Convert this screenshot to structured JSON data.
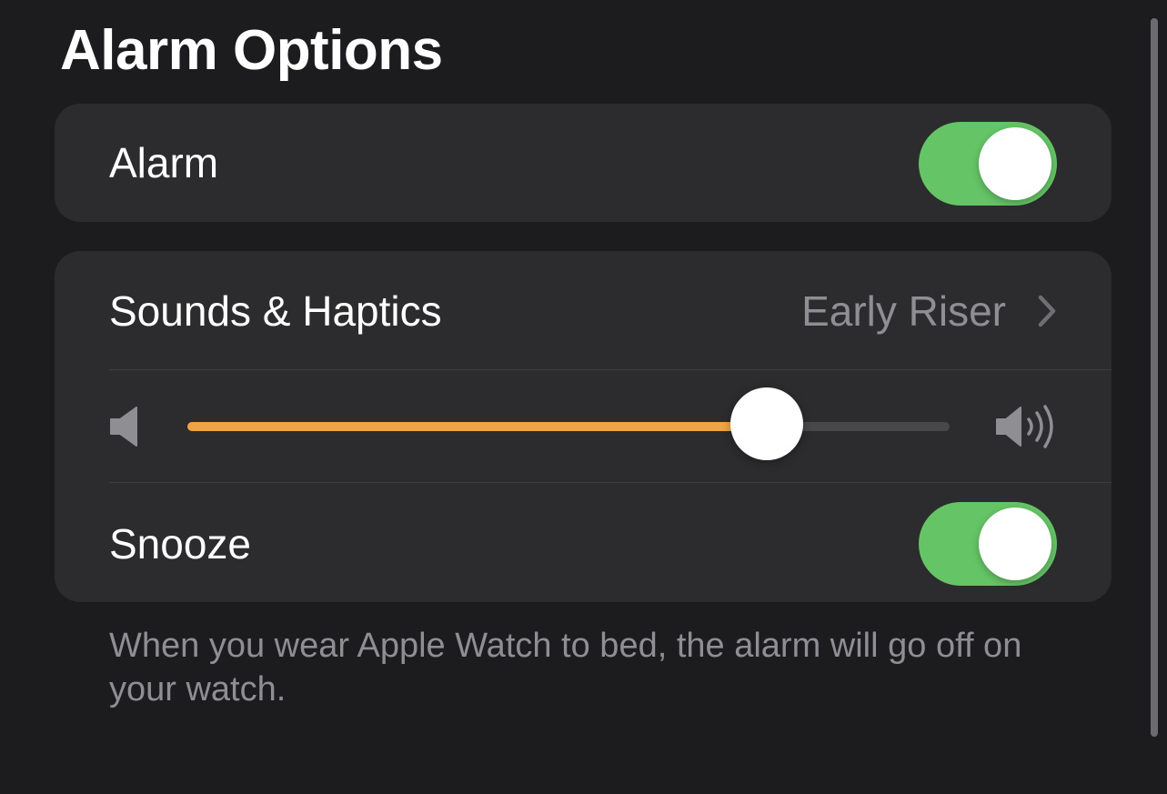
{
  "header": {
    "title": "Alarm Options"
  },
  "alarm_row": {
    "label": "Alarm",
    "toggle_on": true
  },
  "sounds_row": {
    "label": "Sounds & Haptics",
    "value": "Early Riser",
    "icon": "chevron-right-icon"
  },
  "volume": {
    "level": 0.76,
    "low_icon": "speaker-low-icon",
    "high_icon": "speaker-high-icon"
  },
  "snooze_row": {
    "label": "Snooze",
    "toggle_on": true
  },
  "footer": {
    "text": "When you wear Apple Watch to bed, the alarm will go off on your watch."
  },
  "colors": {
    "background": "#1c1c1e",
    "card": "#2c2c2e",
    "toggle_on": "#65c466",
    "slider_fill": "#f0a540",
    "secondary_text": "#8e8e93"
  }
}
